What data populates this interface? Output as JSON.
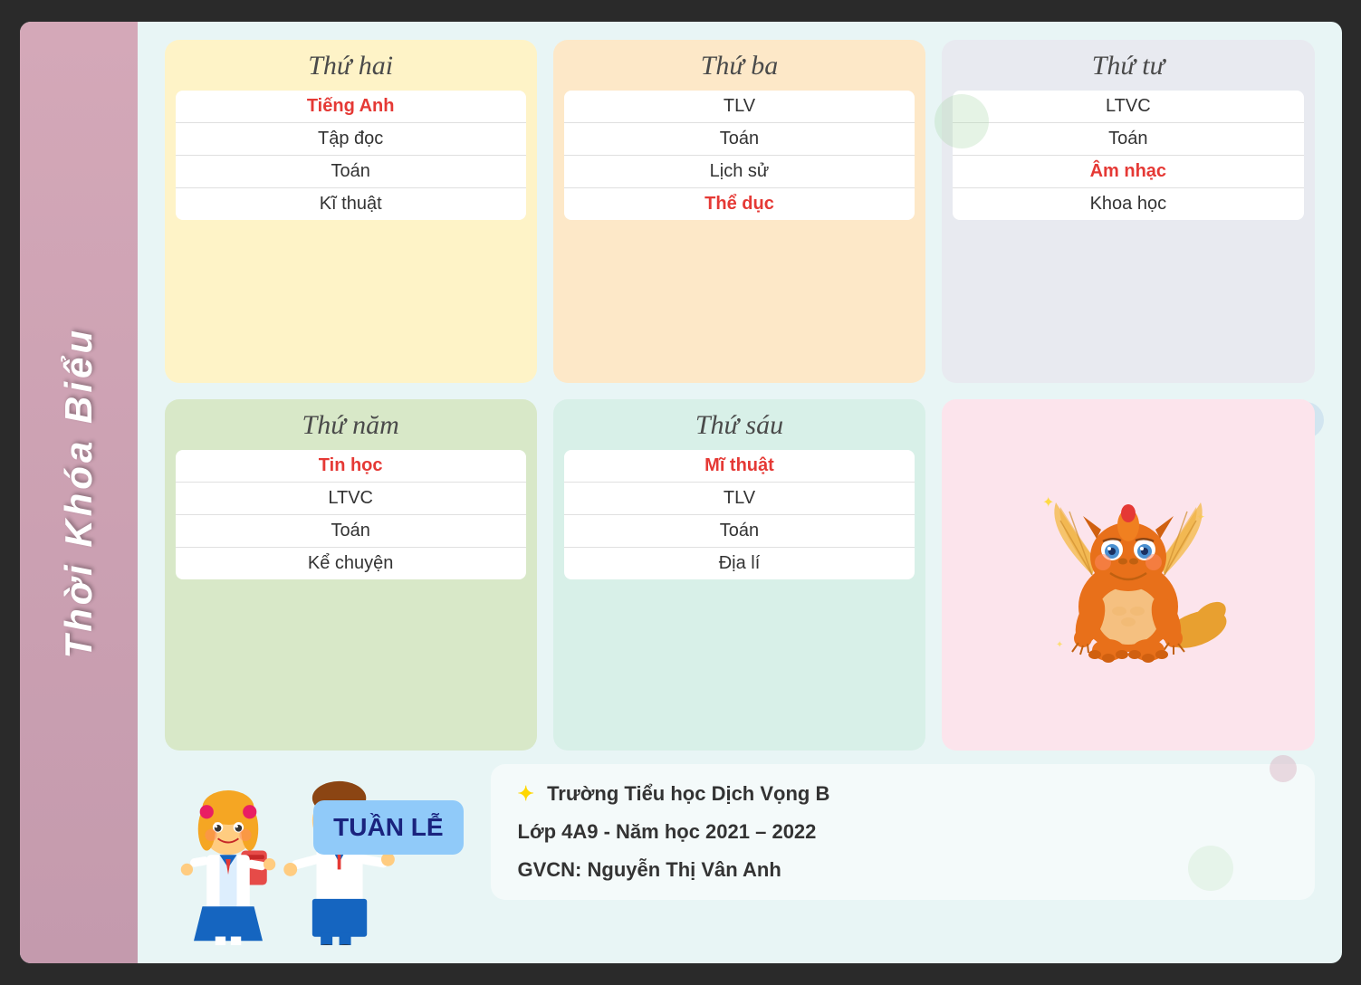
{
  "sidebar": {
    "text": "Thời Khóa Biểu"
  },
  "days": [
    {
      "id": "thu-hai",
      "title": "Thứ hai",
      "color": "yellow",
      "subjects": [
        {
          "name": "Tiếng Anh",
          "highlight": true
        },
        {
          "name": "Tập đọc",
          "highlight": false
        },
        {
          "name": "Toán",
          "highlight": false
        },
        {
          "name": "Kĩ thuật",
          "highlight": false
        }
      ]
    },
    {
      "id": "thu-ba",
      "title": "Thứ ba",
      "color": "peach",
      "subjects": [
        {
          "name": "TLV",
          "highlight": false
        },
        {
          "name": "Toán",
          "highlight": false
        },
        {
          "name": "Lịch sử",
          "highlight": false
        },
        {
          "name": "Thể dục",
          "highlight": true
        }
      ]
    },
    {
      "id": "thu-tu",
      "title": "Thứ tư",
      "color": "silver",
      "subjects": [
        {
          "name": "LTVC",
          "highlight": false
        },
        {
          "name": "Toán",
          "highlight": false
        },
        {
          "name": "Âm nhạc",
          "highlight": true
        },
        {
          "name": "Khoa học",
          "highlight": false
        }
      ]
    },
    {
      "id": "thu-nam",
      "title": "Thứ năm",
      "color": "green",
      "subjects": [
        {
          "name": "Tin học",
          "highlight": true
        },
        {
          "name": "LTVC",
          "highlight": false
        },
        {
          "name": "Toán",
          "highlight": false
        },
        {
          "name": "Kể chuyện",
          "highlight": false
        }
      ]
    },
    {
      "id": "thu-sau",
      "title": "Thứ sáu",
      "color": "mint",
      "subjects": [
        {
          "name": "Mĩ thuật",
          "highlight": true
        },
        {
          "name": "TLV",
          "highlight": false
        },
        {
          "name": "Toán",
          "highlight": false
        },
        {
          "name": "Địa lí",
          "highlight": false
        }
      ]
    }
  ],
  "tuan_le_badge": "TUẦN LỄ",
  "info": {
    "star": "✦",
    "school": "Trường Tiểu học Dịch Vọng B",
    "class": "Lớp 4A9 - Năm học 2021 – 2022",
    "teacher": "GVCN: Nguyễn Thị Vân Anh"
  },
  "colors": {
    "yellow_card": "#fef3c7",
    "peach_card": "#fde8c8",
    "silver_card": "#e8eaf0",
    "green_card": "#d8e8c8",
    "mint_card": "#d8f0e8",
    "pink_card": "#fce4ec",
    "red_highlight": "#e53935",
    "badge_bg": "#90caf9",
    "badge_text": "#1a237e"
  }
}
